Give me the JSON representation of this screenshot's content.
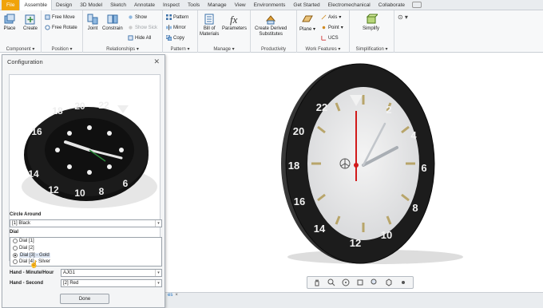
{
  "menu": {
    "tabs": [
      "File",
      "Assemble",
      "Design",
      "3D Model",
      "Sketch",
      "Annotate",
      "Inspect",
      "Tools",
      "Manage",
      "View",
      "Environments",
      "Get Started",
      "Electromechanical",
      "Collaborate"
    ],
    "active": "Assemble"
  },
  "ribbon": {
    "component": {
      "label": "Component",
      "place": "Place",
      "create": "Create"
    },
    "position": {
      "label": "Position",
      "free_move": "Free Move",
      "free_rotate": "Free Rotate"
    },
    "relationships": {
      "label": "Relationships",
      "joint": "Joint",
      "constrain": "Constrain",
      "show": "Show",
      "show_sick": "Show Sick",
      "hide_all": "Hide All"
    },
    "pattern": {
      "label": "Pattern",
      "pattern": "Pattern",
      "mirror": "Mirror",
      "copy": "Copy"
    },
    "manage": {
      "label": "Manage",
      "bill_of_materials": "Bill of\nMaterials",
      "parameters": "Parameters"
    },
    "productivity": {
      "label": "Productivity",
      "create_derived": "Create Derived\nSubstitutes"
    },
    "work_features": {
      "label": "Work Features",
      "plane": "Plane",
      "axis": "Axis",
      "point": "Point",
      "ucs": "UCS"
    },
    "simplification": {
      "label": "Simplification",
      "simplify": "Simplify"
    }
  },
  "dialog": {
    "title": "Configuration",
    "circle_around_label": "Circle Around",
    "circle_around_value": "[1] Black",
    "dial_label": "Dial",
    "dial_options": [
      "Dial [1]",
      "Dial [2]",
      "Dial [3] - Gold",
      "Dial [4] - Silver"
    ],
    "dial_selected_index": 2,
    "hand_hour_label": "Hand - Minute/Hour",
    "hand_hour_value": "AJG1",
    "hand_second_label": "Hand - Second",
    "hand_second_value": "[2] Red",
    "done": "Done"
  },
  "clock": {
    "bezel_numbers": [
      "2",
      "4",
      "6",
      "8",
      "10",
      "12",
      "14",
      "16",
      "18",
      "20",
      "22"
    ],
    "colors": {
      "bezel": "#1c1c1c",
      "face": "#e6e6e6",
      "markers": "#b8a56a",
      "second_hand": "#d11a1a",
      "hands": "#a9aeb4"
    }
  },
  "doc_tab": {
    "label": "es"
  }
}
